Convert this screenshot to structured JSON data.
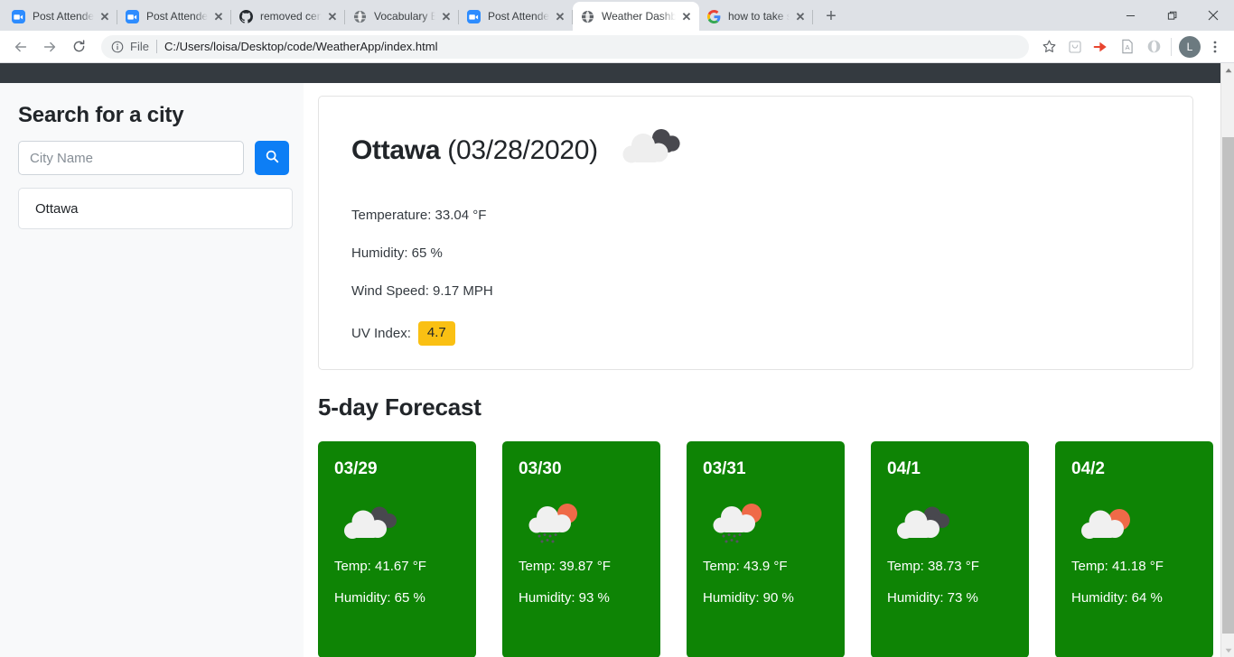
{
  "browser": {
    "tabs": [
      {
        "title": "Post Attendee - Zo",
        "favicon": "zoom-icon",
        "active": false
      },
      {
        "title": "Post Attendee - Zo",
        "favicon": "zoom-icon",
        "active": false
      },
      {
        "title": "removed center-al",
        "favicon": "github-icon",
        "active": false
      },
      {
        "title": "Vocabulary Builder",
        "favicon": "globe-icon",
        "active": false
      },
      {
        "title": "Post Attendee - Zo",
        "favicon": "zoom-icon",
        "active": false
      },
      {
        "title": "Weather Dashboa",
        "favicon": "globe-icon",
        "active": true
      },
      {
        "title": "how to take screen",
        "favicon": "google-icon",
        "active": false
      }
    ],
    "new_tab_label": "+",
    "close_label": "✕",
    "window_controls": {
      "minimize": "–",
      "maximize": "❐",
      "close": "✕"
    },
    "nav": {
      "back": "back-arrow-icon",
      "forward": "forward-arrow-icon",
      "reload": "reload-icon"
    },
    "omnibox": {
      "info_icon": "info-circle-icon",
      "scheme_label": "File",
      "url": "C:/Users/loisa/Desktop/code/WeatherApp/index.html"
    },
    "toolbar_icons": [
      "bookmark-star-icon",
      "extension-icon",
      "adobe-acrobat-icon",
      "pdf-icon",
      "opera-extension-icon"
    ],
    "profile_initial": "L",
    "menu_icon": "kebab-menu-icon"
  },
  "colors": {
    "accent_blue": "#0d7ef5",
    "forecast_green": "#0e8405",
    "uv_badge": "#fac013",
    "navbar_dark": "#343a40",
    "sidebar_bg": "#f8f9fa"
  },
  "sidebar": {
    "heading": "Search for a city",
    "search_placeholder": "City Name",
    "search_value": "",
    "search_button_icon": "search-icon",
    "history": [
      "Ottawa"
    ]
  },
  "current": {
    "city": "Ottawa",
    "date": "(03/28/2020)",
    "icon": "broken-clouds-icon",
    "temperature": "Temperature: 33.04 °F",
    "humidity": "Humidity: 65 %",
    "wind_speed": "Wind Speed: 9.17 MPH",
    "uv_label": "UV Index:",
    "uv_value": "4.7"
  },
  "forecast": {
    "title": "5-day Forecast",
    "days": [
      {
        "date": "03/29",
        "icon": "broken-clouds-icon",
        "temp": "Temp: 41.67 °F",
        "humidity": "Humidity: 65 %"
      },
      {
        "date": "03/30",
        "icon": "sun-rain-clouds-icon",
        "temp": "Temp: 39.87 °F",
        "humidity": "Humidity: 93 %"
      },
      {
        "date": "03/31",
        "icon": "sun-rain-clouds-icon",
        "temp": "Temp: 43.9 °F",
        "humidity": "Humidity: 90 %"
      },
      {
        "date": "04/1",
        "icon": "broken-clouds-icon",
        "temp": "Temp: 38.73 °F",
        "humidity": "Humidity: 73 %"
      },
      {
        "date": "04/2",
        "icon": "sun-clouds-icon",
        "temp": "Temp: 41.18 °F",
        "humidity": "Humidity: 64 %"
      }
    ]
  }
}
